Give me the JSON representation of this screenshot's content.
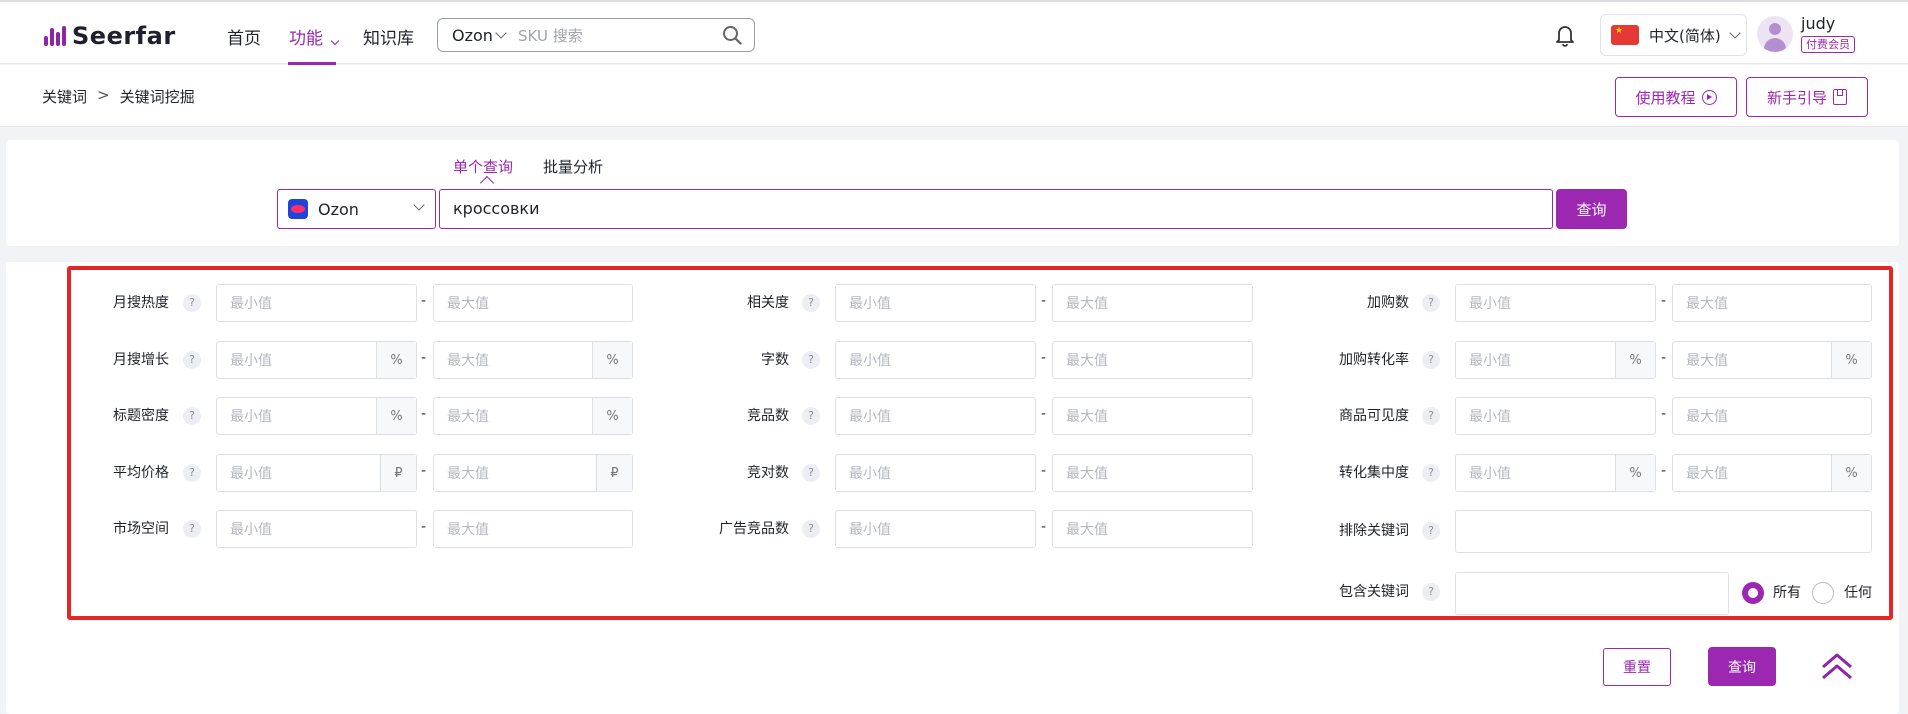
{
  "brand": {
    "name": "Seerfar"
  },
  "nav": {
    "home": "首页",
    "features": "功能",
    "knowledge": "知识库"
  },
  "search": {
    "platform": "Ozon",
    "placeholder": "SKU 搜索"
  },
  "lang": {
    "label": "中文(简体)"
  },
  "user": {
    "name": "judy",
    "badge": "付费会员"
  },
  "breadcrumb": {
    "root": "关键词",
    "sep": ">",
    "current": "关键词挖掘"
  },
  "actions": {
    "tutorial": "使用教程",
    "guide": "新手引导"
  },
  "query": {
    "tab_single": "单个查询",
    "tab_batch": "批量分析",
    "platform": "Ozon",
    "keyword": "кроссовки",
    "submit": "查询"
  },
  "filters": {
    "min_ph": "最小值",
    "max_ph": "最大值",
    "dash": "-",
    "q": "?",
    "pct": "%",
    "rub": "₽",
    "monthly_search": "月搜热度",
    "monthly_growth": "月搜增长",
    "title_density": "标题密度",
    "avg_price": "平均价格",
    "market_space": "市场空间",
    "relevance": "相关度",
    "char_count": "字数",
    "competitor_count": "竞品数",
    "rival_count": "竞对数",
    "ad_competitor_count": "广告竞品数",
    "add_to_cart": "加购数",
    "cart_conversion": "加购转化率",
    "visibility": "商品可见度",
    "conversion_concentration": "转化集中度",
    "exclude_keywords": "排除关键词",
    "include_keywords": "包含关键词",
    "match_all": "所有",
    "match_any": "任何"
  },
  "footer": {
    "reset": "重置",
    "submit": "查询"
  }
}
